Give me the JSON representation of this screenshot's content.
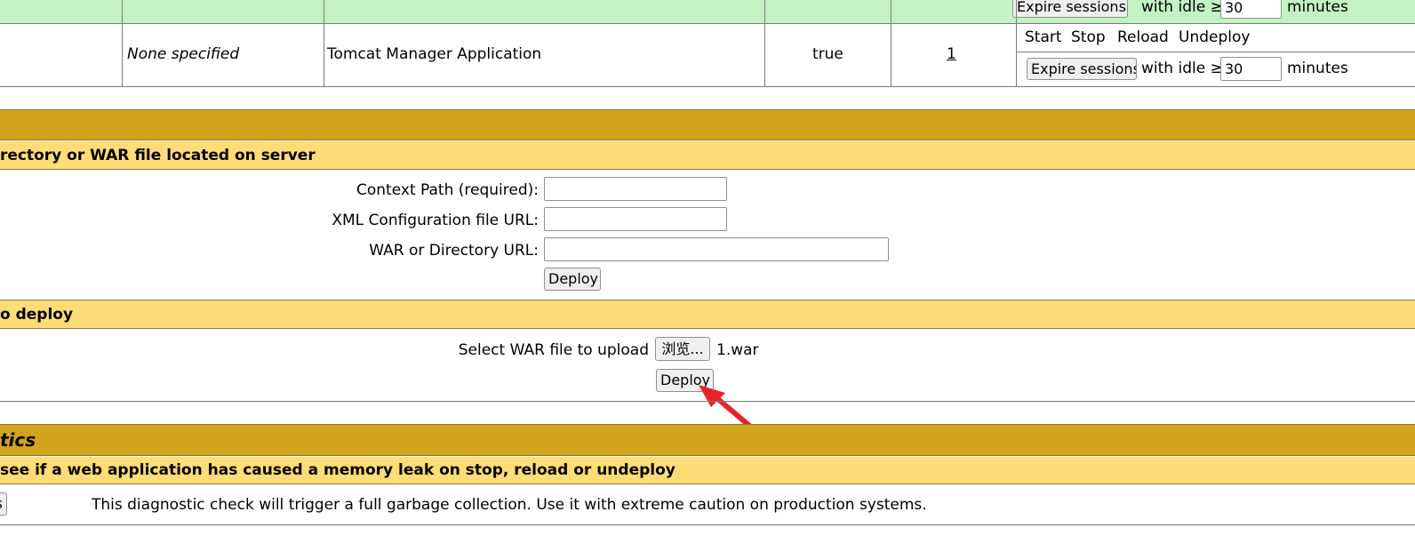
{
  "app_table": {
    "row_partial": {
      "expire_button": "Expire sessions",
      "with_idle": "with idle ≥",
      "idle_value": "30",
      "minutes": "minutes"
    },
    "row_manager": {
      "version": "None specified",
      "display_name": "Tomcat Manager Application",
      "running": "true",
      "sessions": "1",
      "commands": [
        "Start",
        "Stop",
        "Reload",
        "Undeploy"
      ],
      "expire_button": "Expire sessions",
      "with_idle": "with idle ≥",
      "idle_value": "30",
      "minutes": "minutes"
    }
  },
  "deploy": {
    "server_section_title": "rectory or WAR file located on server",
    "context_path_label": "Context Path (required):",
    "context_path_value": "",
    "xml_config_label": "XML Configuration file URL:",
    "xml_config_value": "",
    "war_dir_label": "WAR or Directory URL:",
    "war_dir_value": "",
    "deploy_button": "Deploy",
    "upload_section_title": "o deploy",
    "select_war_label": "Select WAR file to upload",
    "browse_button": "浏览...",
    "selected_file": "1.war",
    "upload_deploy_button": "Deploy"
  },
  "diagnostics": {
    "title": "tics",
    "leak_section_title": "see if a web application has caused a memory leak on stop, reload or undeploy",
    "find_leaks_button_fragment": "s",
    "note": "This diagnostic check will trigger a full garbage collection. Use it with extreme caution on production systems."
  },
  "colors": {
    "header_dark": "#D2A41C",
    "header_light": "#FFDC75",
    "row_green": "#C3F3C3",
    "arrow_red": "#E8222B"
  }
}
